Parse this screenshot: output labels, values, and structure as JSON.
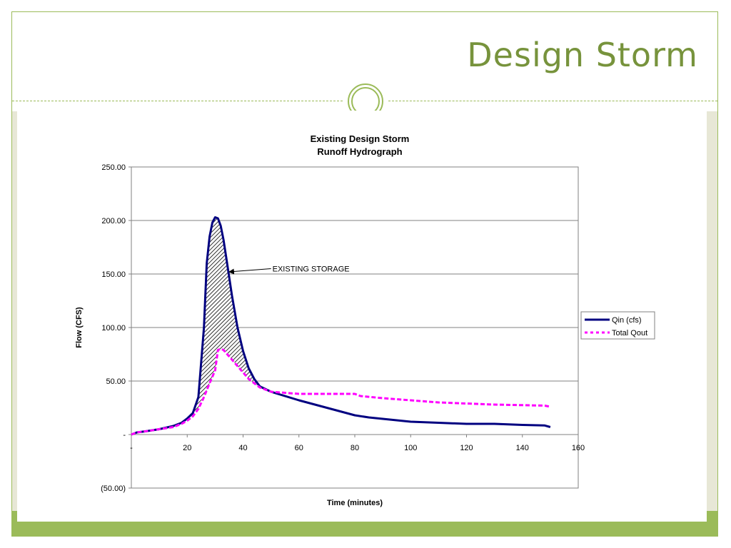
{
  "slide": {
    "title": "Design Storm",
    "accent_color": "#9bbb59",
    "title_color": "#77933c"
  },
  "chart_data": {
    "type": "line",
    "title": "Existing Design Storm",
    "subtitle": "Runoff Hydrograph",
    "xlabel": "Time (minutes)",
    "ylabel": "Flow (CFS)",
    "xlim": [
      0,
      160
    ],
    "ylim": [
      -50,
      250
    ],
    "x_ticks": [
      {
        "value": 0,
        "label": "-"
      },
      {
        "value": 20,
        "label": "20"
      },
      {
        "value": 40,
        "label": "40"
      },
      {
        "value": 60,
        "label": "60"
      },
      {
        "value": 80,
        "label": "80"
      },
      {
        "value": 100,
        "label": "100"
      },
      {
        "value": 120,
        "label": "120"
      },
      {
        "value": 140,
        "label": "140"
      },
      {
        "value": 160,
        "label": "160"
      }
    ],
    "y_ticks": [
      {
        "value": -50,
        "label": "(50.00)"
      },
      {
        "value": 0,
        "label": "-"
      },
      {
        "value": 50,
        "label": "50.00"
      },
      {
        "value": 100,
        "label": "100.00"
      },
      {
        "value": 150,
        "label": "150.00"
      },
      {
        "value": 200,
        "label": "200.00"
      },
      {
        "value": 250,
        "label": "250.00"
      }
    ],
    "grid": "horizontal",
    "legend_position": "right",
    "series": [
      {
        "name": "Qin (cfs)",
        "color": "#000080",
        "style": "solid",
        "x": [
          0,
          2,
          5,
          10,
          15,
          18,
          20,
          22,
          24,
          26,
          27,
          28,
          29,
          30,
          31,
          32,
          33,
          34,
          36,
          38,
          40,
          42,
          44,
          46,
          50,
          60,
          70,
          80,
          85,
          100,
          110,
          120,
          130,
          140,
          148,
          150
        ],
        "y": [
          0,
          2,
          3,
          5,
          8,
          11,
          15,
          20,
          35,
          100,
          160,
          185,
          198,
          203,
          202,
          195,
          182,
          165,
          130,
          100,
          78,
          62,
          52,
          45,
          40,
          32,
          25,
          18,
          16,
          12,
          11,
          10,
          10,
          9,
          8.5,
          7
        ]
      },
      {
        "name": "Total Qout",
        "color": "#ff00ff",
        "style": "dashed",
        "x": [
          0,
          2,
          5,
          10,
          15,
          18,
          20,
          22,
          24,
          26,
          28,
          30,
          31,
          32,
          33,
          34,
          36,
          38,
          40,
          42,
          44,
          46,
          48,
          50,
          55,
          60,
          70,
          80,
          82,
          90,
          100,
          110,
          120,
          130,
          140,
          148,
          150
        ],
        "y": [
          0,
          2,
          3,
          5,
          7,
          10,
          13,
          17,
          24,
          35,
          48,
          60,
          79,
          80,
          79,
          76,
          70,
          64,
          58,
          52,
          48,
          44,
          42,
          40,
          39,
          38,
          38,
          38,
          36,
          34,
          32,
          30,
          29,
          28,
          27.5,
          27,
          26
        ]
      }
    ],
    "annotations": [
      {
        "text": "EXISTING STORAGE",
        "x": 50,
        "y": 155,
        "arrow_to_x": 35,
        "arrow_to_y": 152
      }
    ],
    "shaded_region": {
      "between": [
        "Qin (cfs)",
        "Total Qout"
      ],
      "x_range": [
        18,
        46
      ],
      "pattern": "hatch"
    }
  }
}
